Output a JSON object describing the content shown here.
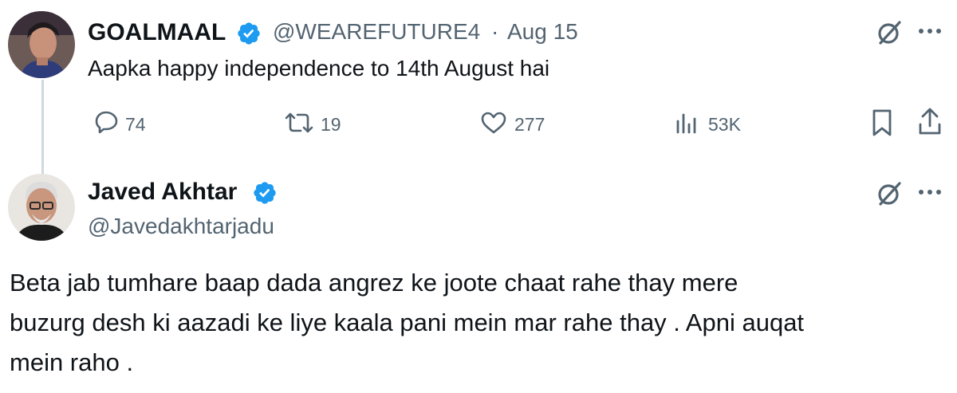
{
  "tweet1": {
    "display_name": "GOALMAAL",
    "handle": "@WEAREFUTURE4",
    "separator": "·",
    "date": "Aug 15",
    "text": "Aapka happy independence to 14th August hai",
    "replies": "74",
    "retweets": "19",
    "likes": "277",
    "views": "53K"
  },
  "tweet2": {
    "display_name": "Javed Akhtar",
    "handle": "@Javedakhtarjadu",
    "text_lines": [
      "Beta jab tumhare baap dada angrez ke joote chaat rahe thay mere",
      "buzurg desh ki aazadi ke liye kaala pani mein mar rahe thay . Apni auqat",
      "mein raho ."
    ]
  },
  "colors": {
    "verified": "#1d9bf0",
    "secondary_text": "#536471",
    "primary_text": "#0f1419",
    "thread_line": "#cfd9de"
  }
}
